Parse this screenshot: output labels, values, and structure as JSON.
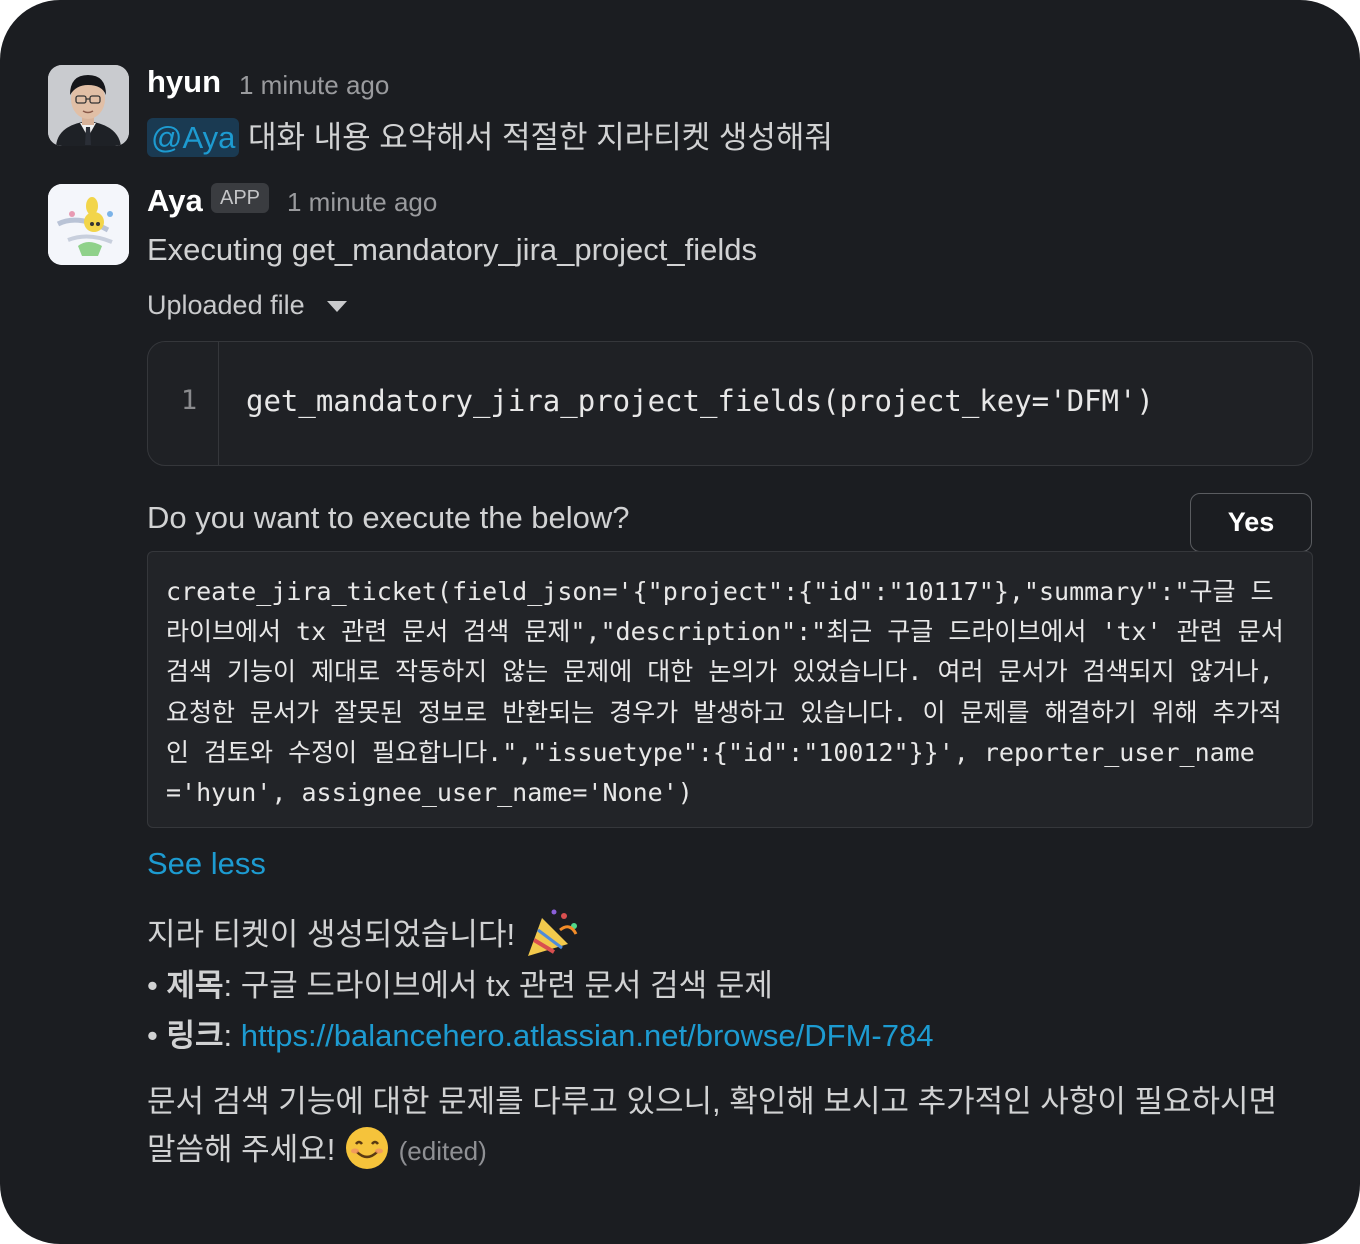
{
  "messages": {
    "hyun": {
      "username": "hyun",
      "timestamp": "1 minute ago",
      "mention": "@Aya",
      "text": "대화 내용 요약해서 적절한 지라티켓 생성해줘"
    },
    "aya": {
      "username": "Aya",
      "badge": "APP",
      "timestamp": "1 minute ago",
      "executing": "Executing get_mandatory_jira_project_fields",
      "uploaded_file_label": "Uploaded file",
      "code_line_number": "1",
      "code_line": "get_mandatory_jira_project_fields(project_key='DFM')",
      "prompt": "Do you want to execute the below?",
      "yes_label": "Yes",
      "command": "create_jira_ticket(field_json='{\"project\":{\"id\":\"10117\"},\"summary\":\"구글 드라이브에서 tx 관련 문서 검색 문제\",\"description\":\"최근 구글 드라이브에서 'tx' 관련 문서 검색 기능이 제대로 작동하지 않는 문제에 대한 논의가 있었습니다. 여러 문서가 검색되지 않거나, 요청한 문서가 잘못된 정보로 반환되는 경우가 발생하고 있습니다. 이 문제를 해결하기 위해 추가적인 검토와 수정이 필요합니다.\",\"issuetype\":{\"id\":\"10012\"}}', reporter_user_name='hyun', assignee_user_name='None')",
      "see_less": "See less",
      "created_text": "지라 티켓이 생성되었습니다!",
      "title_label": "제목",
      "title_value": "구글 드라이브에서 tx 관련 문서 검색 문제",
      "link_label": "링크",
      "link_url": "https://balancehero.atlassian.net/browse/DFM-784",
      "closing_line1": "문서 검색 기능에 대한 문제를 다루고 있으니, 확인해 보시고 추가적인 사항이 필요하시면",
      "closing_line2": "말씀해 주세요!",
      "edited": "(edited)"
    }
  },
  "icons": {
    "party": "party-popper-icon",
    "smile": "smiling-face-icon",
    "caret": "caret-down-icon"
  },
  "colors": {
    "background": "#1b1d21",
    "link": "#1d9bd1",
    "mention_bg": "#1a3a52"
  }
}
